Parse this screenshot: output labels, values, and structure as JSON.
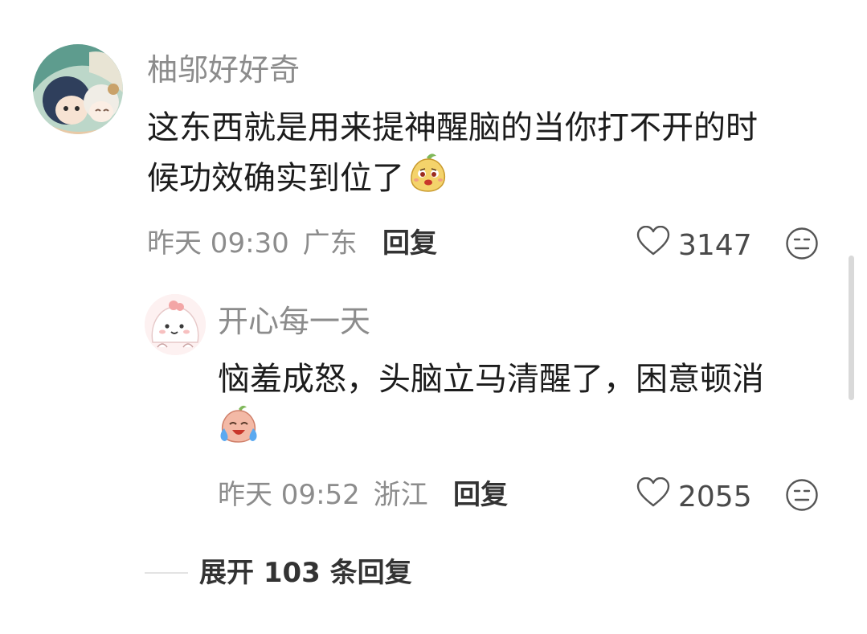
{
  "comment": {
    "username": "柚邬好好奇",
    "text_line1": "这东西就是用来提神醒脑的当你打不开的时",
    "text_line2": "候功效确实到位了",
    "emoji": "smirk-face-emoji",
    "time": "昨天 09:30",
    "location": "广东",
    "reply_label": "回复",
    "likes": "3147",
    "like_icon": "heart-icon",
    "dislike_icon": "neutral-face-icon"
  },
  "reply": {
    "username": "开心每一天",
    "text_line1": "恼羞成怒，头脑立马清醒了，困意顿消",
    "emoji": "laughing-crying-emoji",
    "time": "昨天 09:52",
    "location": "浙江",
    "reply_label": "回复",
    "likes": "2055",
    "like_icon": "heart-icon",
    "dislike_icon": "neutral-face-icon"
  },
  "expand": {
    "label": "展开 103 条回复"
  },
  "colors": {
    "text": "#1c1c1c",
    "muted": "#8c8c8c",
    "action": "#333333",
    "emoji_yellow": "#f4d36b",
    "emoji_peach": "#f3b9a6"
  }
}
